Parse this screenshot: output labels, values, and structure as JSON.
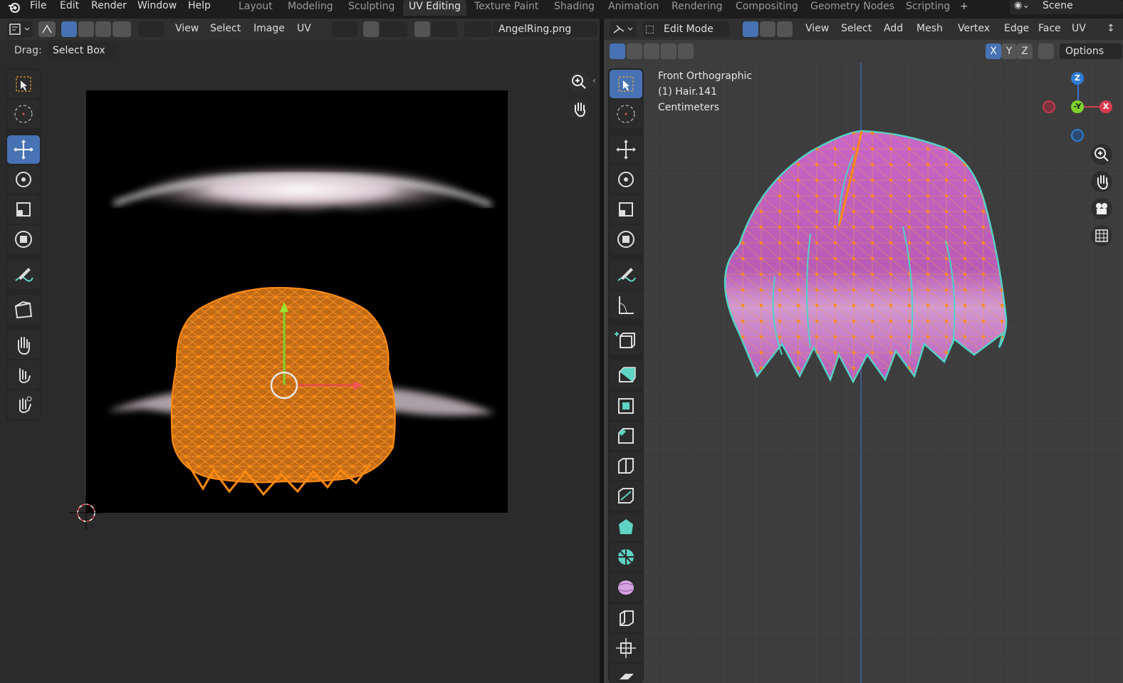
{
  "menubar": {
    "items": [
      "File",
      "Edit",
      "Render",
      "Window",
      "Help"
    ]
  },
  "workspaces": {
    "tabs": [
      "Layout",
      "Modeling",
      "Sculpting",
      "UV Editing",
      "Texture Paint",
      "Shading",
      "Animation",
      "Rendering",
      "Compositing",
      "Geometry Nodes",
      "Scripting"
    ],
    "active": "UV Editing",
    "add": "+"
  },
  "scene": {
    "label": "Scene"
  },
  "uv_editor": {
    "menus": [
      "View",
      "Select",
      "Image",
      "UV"
    ],
    "image_name": "AngelRing.png",
    "drag_label": "Drag:",
    "drag_value": "Select Box"
  },
  "viewport": {
    "mode": "Edit Mode",
    "menus": [
      "View",
      "Select",
      "Add",
      "Mesh",
      "Vertex",
      "Edge",
      "Face",
      "UV"
    ],
    "axes": [
      "X",
      "Y",
      "Z"
    ],
    "options_label": "Options",
    "overlay": [
      "Front Orthographic",
      "(1) Hair.141",
      "Centimeters"
    ],
    "gizmo": {
      "z": "Z",
      "y": "-Y",
      "x": "X"
    }
  },
  "colors": {
    "accent": "#4772b3",
    "selection": "#ff8a10",
    "mesh": "#c35fc0",
    "edge_highlight": "#52d1c8"
  }
}
